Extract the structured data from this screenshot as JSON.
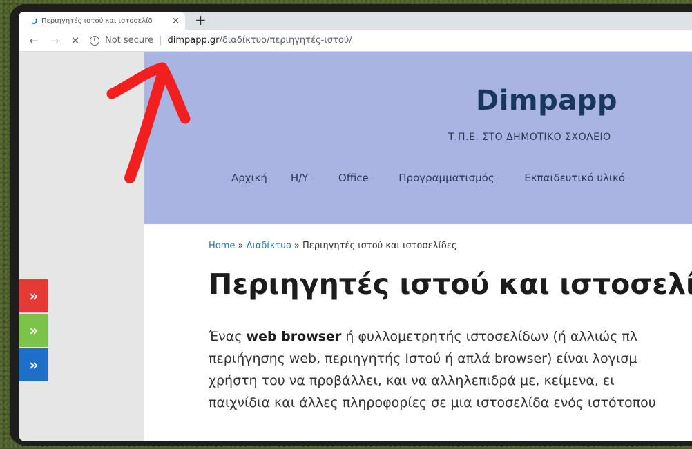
{
  "colors": {
    "header_bg": "#a9b4e2",
    "site_title": "#17385c",
    "link": "#2a7ab0",
    "share_red": "#e53935",
    "share_green": "#7cc34a",
    "share_blue": "#1e6fc8",
    "annotation_arrow": "#f21f1f"
  },
  "browser": {
    "tab": {
      "title": "Περιηγητές ιστού και ιστοσελίδ",
      "close": "×",
      "new_tab": "+",
      "loading": true
    },
    "toolbar": {
      "back": "←",
      "forward": "→",
      "stop": "✕",
      "info_icon": "i",
      "not_secure": "Not secure",
      "separator": "|",
      "url_host": "dimpapp.gr",
      "url_path": "/διαδίκτυο/περιηγητές-ιστού/"
    }
  },
  "share_buttons": [
    {
      "label": "»",
      "color": "#e53935",
      "icon": "double-chevron-right-icon"
    },
    {
      "label": "»",
      "color": "#7cc34a",
      "icon": "double-chevron-right-icon"
    },
    {
      "label": "»",
      "color": "#1e6fc8",
      "icon": "double-chevron-right-icon"
    }
  ],
  "site": {
    "title": "Dimpapp",
    "tagline": "Τ.Π.Ε. ΣΤΟ ΔΗΜΟΤΙΚΟ ΣΧΟΛΕΙΟ",
    "menu": [
      {
        "label": "Αρχική",
        "dropdown": false
      },
      {
        "label": "Η/Υ",
        "dropdown": true
      },
      {
        "label": "Office",
        "dropdown": true
      },
      {
        "label": "Προγραμματισμός",
        "dropdown": true
      },
      {
        "label": "Εκπαιδευτικό υλικό",
        "dropdown": true
      }
    ],
    "caret": "⌄"
  },
  "page": {
    "breadcrumb": {
      "home": "Home",
      "sep": " » ",
      "section": "Διαδίκτυο",
      "current": "Περιηγητές ιστού και ιστοσελίδες"
    },
    "heading": "Περιηγητές ιστού και ιστοσελίδε",
    "paragraph": {
      "line1_pre": "Ένας ",
      "line1_bold": "web browser",
      "line1_post": " ή φυλλομετρητής ιστοσελίδων (ή αλλιώς πλ",
      "line2": "περιήγησης web, περιηγητής Ιστού ή απλά browser) είναι λογισμ",
      "line3": "χρήστη του να προβάλλει, και να αλληλεπιδρά με, κείμενα, ει",
      "line4": "παιχνίδια και άλλες πληροφορίες σε μια ιστοσελίδα ενός ιστότοπου"
    }
  }
}
